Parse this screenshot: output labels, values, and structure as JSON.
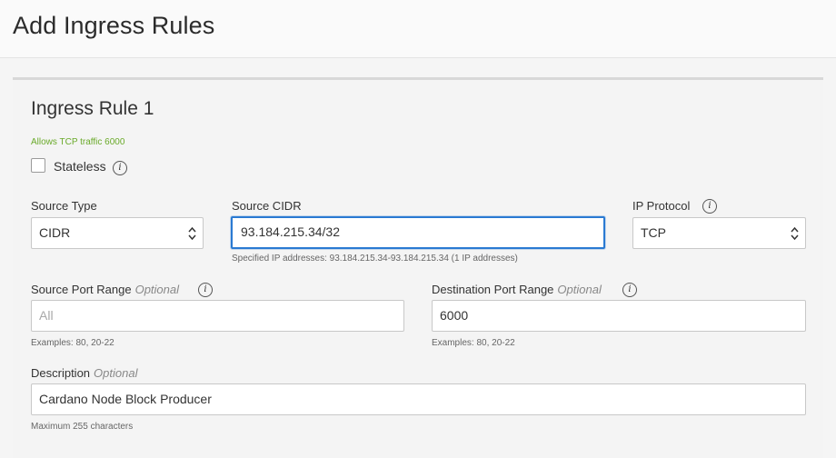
{
  "header": {
    "title": "Add Ingress Rules"
  },
  "rule": {
    "title": "Ingress Rule 1",
    "summary": "Allows TCP traffic 6000",
    "stateless": {
      "label": "Stateless",
      "checked": false
    },
    "source_type": {
      "label": "Source Type",
      "value": "CIDR"
    },
    "source_cidr": {
      "label": "Source CIDR",
      "value": "93.184.215.34/32",
      "help": "Specified IP addresses: 93.184.215.34-93.184.215.34 (1 IP addresses)"
    },
    "ip_protocol": {
      "label": "IP Protocol",
      "value": "TCP"
    },
    "source_port_range": {
      "label": "Source Port Range",
      "optional": "Optional",
      "placeholder": "All",
      "help": "Examples: 80, 20-22"
    },
    "destination_port_range": {
      "label": "Destination Port Range",
      "optional": "Optional",
      "value": "6000",
      "help": "Examples: 80, 20-22"
    },
    "description": {
      "label": "Description",
      "optional": "Optional",
      "value": "Cardano Node Block Producer",
      "help": "Maximum 255 characters"
    }
  },
  "icons": {
    "info": "i"
  },
  "colors": {
    "accent": "#2a7ad2",
    "summary": "#6aaa2a"
  }
}
